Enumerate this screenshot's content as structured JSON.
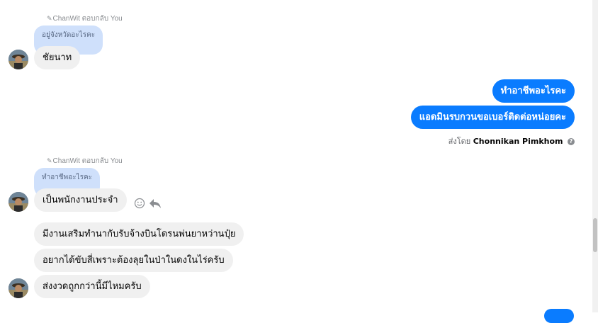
{
  "thread": {
    "group1": {
      "reply_label": "ChanWit ตอบกลับ You",
      "quoted": "อยู่จังหวัดอะไรคะ",
      "message": "ชัยนาท"
    },
    "outgoing": {
      "messages": [
        "ทำอาชีพอะไรคะ",
        "แอดมินรบกวนขอเบอร์ติดต่อหน่อยคะ"
      ],
      "sent_by_prefix": "ส่งโดย",
      "sent_by_name": "Chonnikan Pimkhom"
    },
    "group2": {
      "reply_label": "ChanWit ตอบกลับ You",
      "quoted": "ทำอาชีพอะไรคะ",
      "messages": [
        "เป็นพนักงานประจำ",
        "มีงานเสริมทำนากับรับจ้างบินโดรนพ่นยาหว่านปุ๋ย",
        "อยากได้ขับสี่เพราะต้องลุยในป่าในดงในไร่ครับ",
        "ส่งงวดถูกกว่านี้มีไหมครับ"
      ]
    }
  },
  "icons": {
    "reply": "reply-arrow-icon",
    "react": "smiley-icon",
    "help": "question-circle-icon",
    "edit": "pencil-icon"
  },
  "colors": {
    "outgoing_bubble": "#0a7cff",
    "incoming_bubble": "#f0f0f0",
    "quoted_bubble": "#cfe0fb"
  }
}
